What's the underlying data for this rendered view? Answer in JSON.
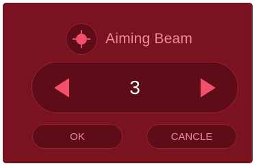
{
  "dialog": {
    "title": "Aiming Beam",
    "icon": "crosshair-icon",
    "value": "3",
    "ok_label": "OK",
    "cancel_label": "CANCLE"
  },
  "colors": {
    "panel": "#7a1220",
    "inset": "#5d0c18",
    "accent": "#f2506a",
    "text": "#f08a9b",
    "value_text": "#ffffff"
  }
}
